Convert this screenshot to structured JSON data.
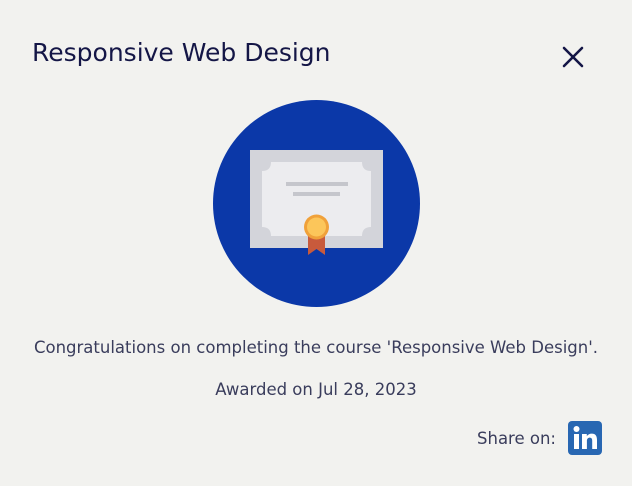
{
  "dialog": {
    "title": "Responsive Web Design",
    "close_icon": "close-icon",
    "badge_icon": "certificate-icon",
    "message": "Congratulations on completing the course 'Responsive Web Design'.",
    "awarded": "Awarded on Jul 28, 2023",
    "share_label": "Share on:",
    "share_icon": "linkedin-icon"
  },
  "colors": {
    "background": "#f2f2ef",
    "title": "#141646",
    "text": "#3a3d5c",
    "badge_circle": "#0b38a8",
    "linkedin": "#2867b2"
  }
}
